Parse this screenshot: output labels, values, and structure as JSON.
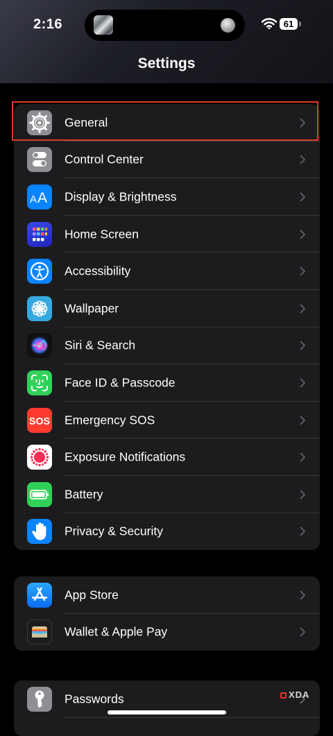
{
  "status_bar": {
    "time": "2:16",
    "battery": "61"
  },
  "nav": {
    "title": "Settings"
  },
  "groups": [
    {
      "items": [
        {
          "label": "General",
          "icon": "gear-icon",
          "color": "#8e8e93"
        },
        {
          "label": "Control Center",
          "icon": "toggles-icon",
          "color": "#8e8e93"
        },
        {
          "label": "Display & Brightness",
          "icon": "text-size-icon",
          "color": "#0a84ff"
        },
        {
          "label": "Home Screen",
          "icon": "app-grid-icon",
          "color": "#2d36d8"
        },
        {
          "label": "Accessibility",
          "icon": "accessibility-icon",
          "color": "#0a84ff"
        },
        {
          "label": "Wallpaper",
          "icon": "flower-icon",
          "color": "#35a9e0"
        },
        {
          "label": "Siri & Search",
          "icon": "siri-icon",
          "color": "#1a1a1a"
        },
        {
          "label": "Face ID & Passcode",
          "icon": "face-id-icon",
          "color": "#30d158"
        },
        {
          "label": "Emergency SOS",
          "icon": "sos-icon",
          "color": "#ff3b30"
        },
        {
          "label": "Exposure Notifications",
          "icon": "exposure-icon",
          "color": "#ffffff"
        },
        {
          "label": "Battery",
          "icon": "battery-icon",
          "color": "#30d158"
        },
        {
          "label": "Privacy & Security",
          "icon": "hand-icon",
          "color": "#0a84ff"
        }
      ]
    },
    {
      "items": [
        {
          "label": "App Store",
          "icon": "app-store-icon",
          "color": "#0a84ff"
        },
        {
          "label": "Wallet & Apple Pay",
          "icon": "wallet-icon",
          "color": "#1c1c1e"
        }
      ]
    },
    {
      "items": [
        {
          "label": "Passwords",
          "icon": "key-icon",
          "color": "#8e8e93"
        }
      ]
    }
  ],
  "highlighted_item": "General",
  "watermark": "XDA",
  "accent_colors": {
    "highlight_border": "#e0392b",
    "group_bg": "#1c1c1e"
  }
}
